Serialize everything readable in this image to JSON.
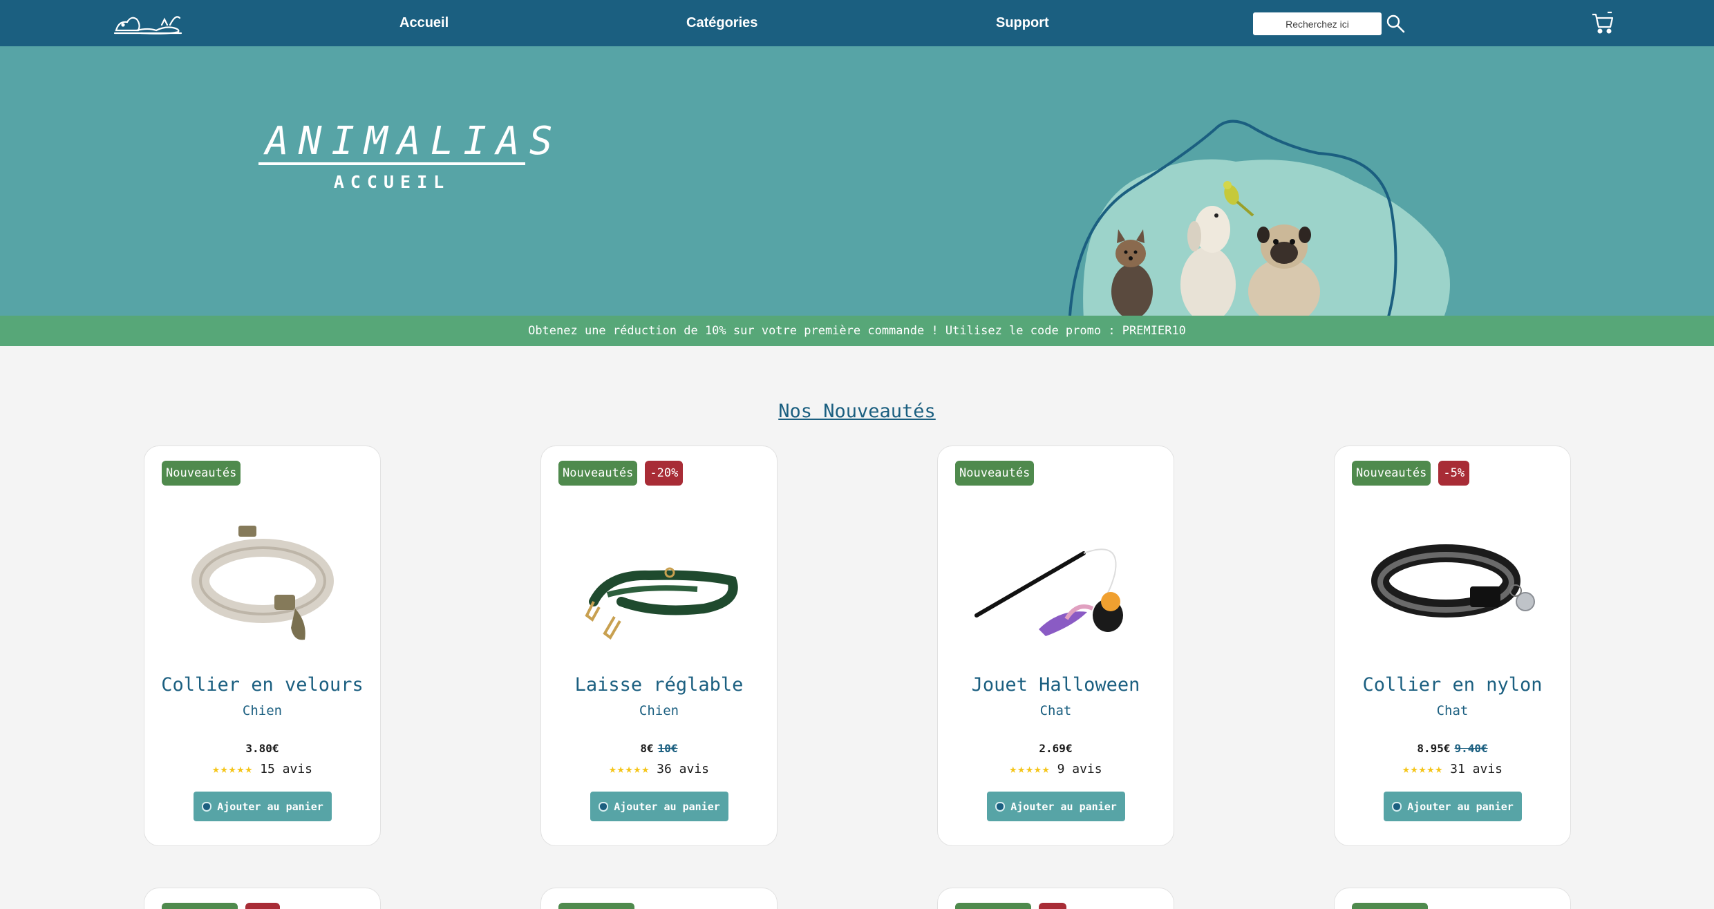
{
  "nav": {
    "links": [
      "Accueil",
      "Catégories",
      "Support"
    ],
    "search_placeholder": "Recherchez ici"
  },
  "hero": {
    "brand": "ANIMALIAS",
    "subtitle": "ACCUEIL"
  },
  "promo": "Obtenez une réduction de 10% sur votre première commande ! Utilisez le code promo : PREMIER10",
  "section_title": "Nos Nouveautés",
  "colors": {
    "nav": "#1b5f80",
    "hero": "#57a4a6",
    "promo": "#57a778",
    "badge_new": "#4f8a4d",
    "badge_discount": "#a82c36",
    "stars": "#f5c518"
  },
  "products": [
    {
      "badge": "Nouveautés",
      "discount": "",
      "name": "Collier en velours",
      "category": "Chien",
      "price": "3.80€",
      "old_price": "",
      "stars": "★★★★★",
      "reviews": "15 avis",
      "button": "Ajouter au panier",
      "image": "velvet-collar"
    },
    {
      "badge": "Nouveautés",
      "discount": "-20%",
      "name": "Laisse réglable",
      "category": "Chien",
      "price": "8€",
      "old_price": "10€",
      "stars": "★★★★★",
      "reviews": "36 avis",
      "button": "Ajouter au panier",
      "image": "green-leash"
    },
    {
      "badge": "Nouveautés",
      "discount": "",
      "name": "Jouet Halloween",
      "category": "Chat",
      "price": "2.69€",
      "old_price": "",
      "stars": "★★★★★",
      "reviews": "9 avis",
      "button": "Ajouter au panier",
      "image": "cat-wand-toy"
    },
    {
      "badge": "Nouveautés",
      "discount": "-5%",
      "name": "Collier en nylon",
      "category": "Chat",
      "price": "8.95€",
      "old_price": "9.40€",
      "stars": "★★★★★",
      "reviews": "31 avis",
      "button": "Ajouter au panier",
      "image": "nylon-collar"
    }
  ]
}
